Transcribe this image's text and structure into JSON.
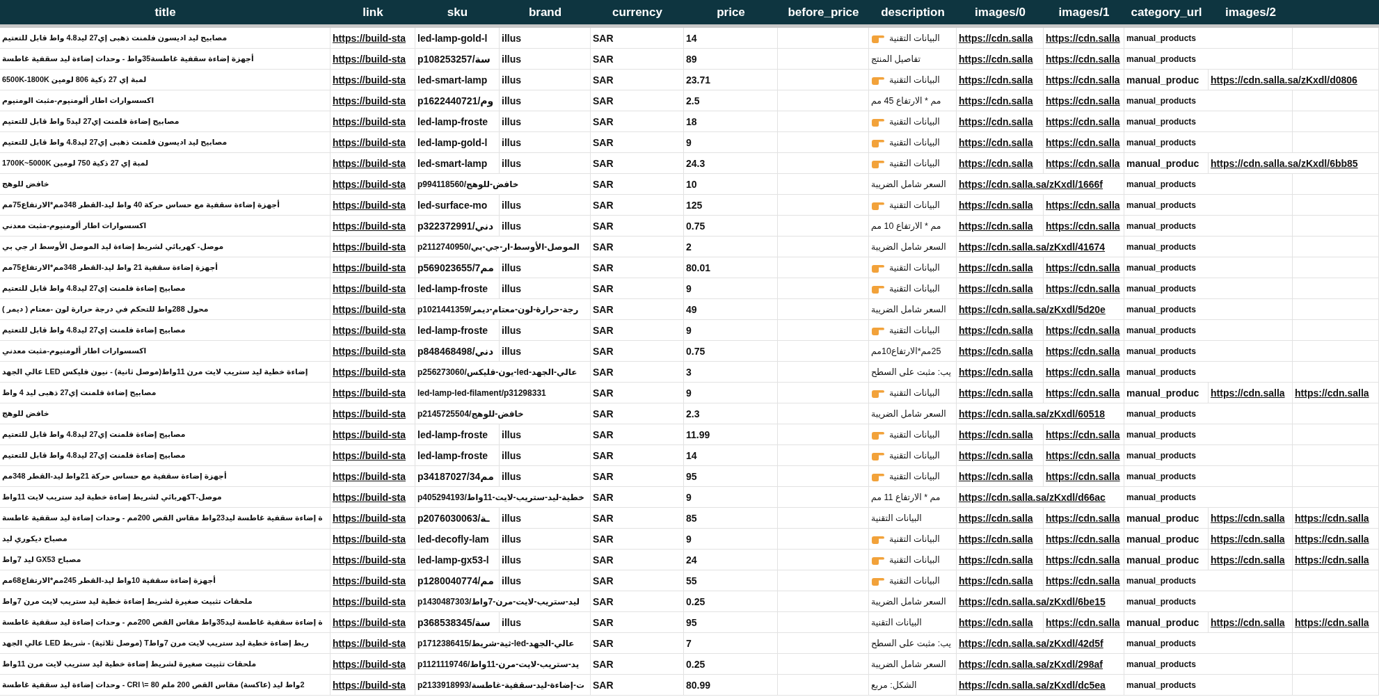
{
  "columns": [
    "title",
    "link",
    "sku",
    "brand",
    "currency",
    "price",
    "before_price",
    "description",
    "images/0",
    "images/1",
    "category_url",
    "images/2",
    ""
  ],
  "rows": [
    {
      "title": "مصابيح ليد اديسون فلمنت ذهبى إي27 ليد4.8 واط قابل للتعتيم",
      "link": "https://build-sta",
      "sku": "led-lamp-gold-l",
      "brand": "illus",
      "currency": "SAR",
      "price": "14",
      "description": {
        "text": "البيانات التقنية",
        "icon": true
      },
      "images/0": "https://cdn.salla",
      "images/1": "https://cdn.salla",
      "category_url": "manual_products"
    },
    {
      "title": "أجهزة إضاءة سقفية غاطسة35واط - وحدات إضاءة ليد سقفية غاطسة",
      "link": "https://build-sta",
      "sku": "p108253257/سة",
      "brand": "illus",
      "currency": "SAR",
      "price": "89",
      "description": {
        "text": "تفاصيل المنتج",
        "icon": false
      },
      "images/0": "https://cdn.salla",
      "images/1": "https://cdn.salla",
      "category_url": "manual_products"
    },
    {
      "title": "لمبة إي 27 ذكية 806 لومين 6500K-1800K",
      "link": "https://build-sta",
      "sku": "led-smart-lamp",
      "brand": "illus",
      "currency": "SAR",
      "price": "23.71",
      "description": {
        "text": "البيانات التقنية",
        "icon": true
      },
      "images/0": "https://cdn.salla",
      "images/1": "https://cdn.salla",
      "category_url": "manual_produc",
      "images/2": "https://cdn.salla.sa/zKxdl/d0806"
    },
    {
      "title": "اكسسوارات اطار ألومنيوم-مثبت الومنيوم",
      "link": "https://build-sta",
      "sku": "p1622440721/وم",
      "brand": "illus",
      "currency": "SAR",
      "price": "2.5",
      "description": {
        "text": "مم * الارتفاع 45 مم",
        "icon": false
      },
      "images/0": "https://cdn.salla",
      "images/1": "https://cdn.salla",
      "category_url": "manual_products"
    },
    {
      "title": "مصابيح إضاءة فلمنت إي27 ليد5 واط قابل للتعتيم",
      "link": "https://build-sta",
      "sku": "led-lamp-froste",
      "brand": "illus",
      "currency": "SAR",
      "price": "18",
      "description": {
        "text": "البيانات التقنية",
        "icon": true
      },
      "images/0": "https://cdn.salla",
      "images/1": "https://cdn.salla",
      "category_url": "manual_products"
    },
    {
      "title": "مصابيح ليد اديسون فلمنت ذهبى إي27 ليد4.8 واط قابل للتعتيم",
      "link": "https://build-sta",
      "sku": "led-lamp-gold-l",
      "brand": "illus",
      "currency": "SAR",
      "price": "9",
      "description": {
        "text": "البيانات التقنية",
        "icon": true
      },
      "images/0": "https://cdn.salla",
      "images/1": "https://cdn.salla",
      "category_url": "manual_products"
    },
    {
      "title": "لمبة إي 27 ذكية 750 لومين 1700K~5000K",
      "link": "https://build-sta",
      "sku": "led-smart-lamp",
      "brand": "illus",
      "currency": "SAR",
      "price": "24.3",
      "description": {
        "text": "البيانات التقنية",
        "icon": true
      },
      "images/0": "https://cdn.salla",
      "images/1": "https://cdn.salla",
      "category_url": "manual_produc",
      "images/2": "https://cdn.salla.sa/zKxdl/6bb85"
    },
    {
      "title": "خافض للوهج",
      "link": "https://build-sta",
      "sku": "p994118560/خافض-للوهج",
      "currency": "SAR",
      "price": "10",
      "description": {
        "text": "السعر شامل الضريبة",
        "icon": false
      },
      "images/0": "https://cdn.salla.sa/zKxdl/1666f",
      "category_url": "manual_products"
    },
    {
      "title": "أجهزة إضاءة سقفية مع حساس حركة 40 واط ليد-القطر 348مم*الارتفاع75مم",
      "link": "https://build-sta",
      "sku": "led-surface-mo",
      "brand": "illus",
      "currency": "SAR",
      "price": "125",
      "description": {
        "text": "البيانات التقنية",
        "icon": true
      },
      "images/0": "https://cdn.salla",
      "images/1": "https://cdn.salla",
      "category_url": "manual_products"
    },
    {
      "title": "اكسسوارات اطار ألومنيوم-مثبت معدني",
      "link": "https://build-sta",
      "sku": "p322372991/دني",
      "brand": "illus",
      "currency": "SAR",
      "price": "0.75",
      "description": {
        "text": "مم * الارتفاع 10 مم",
        "icon": false
      },
      "images/0": "https://cdn.salla",
      "images/1": "https://cdn.salla",
      "category_url": "manual_products"
    },
    {
      "title": "موصل- كهربائي لشريط إضاءة ليد الموصل الأوسط ار جي بي",
      "link": "https://build-sta",
      "sku": "p2112740950/الموصل-الأوسط-ار-جي-بي",
      "currency": "SAR",
      "price": "2",
      "description": {
        "text": "السعر شامل الضريبة",
        "icon": false
      },
      "images/0": "https://cdn.salla.sa/zKxdl/41674",
      "category_url": "manual_products"
    },
    {
      "title": "أجهزة إضاءة سقفية 21 واط ليد-القطر 348مم*الارتفاع75مم",
      "link": "https://build-sta",
      "sku": "p569023655/7مم",
      "brand": "illus",
      "currency": "SAR",
      "price": "80.01",
      "description": {
        "text": "البيانات التقنية",
        "icon": true
      },
      "images/0": "https://cdn.salla",
      "images/1": "https://cdn.salla",
      "category_url": "manual_products"
    },
    {
      "title": "مصابيح إضاءة فلمنت إي27 ليد4.8 واط قابل للتعتيم",
      "link": "https://build-sta",
      "sku": "led-lamp-froste",
      "brand": "illus",
      "currency": "SAR",
      "price": "9",
      "description": {
        "text": "البيانات التقنية",
        "icon": true
      },
      "images/0": "https://cdn.salla",
      "images/1": "https://cdn.salla",
      "category_url": "manual_products"
    },
    {
      "title": "محول 288واط للتحكم في درجة حرارة لون -معتام ( ديمر )",
      "link": "https://build-sta",
      "sku": "p1021441359/رجة-حرارة-لون-معتام-ديمر",
      "currency": "SAR",
      "price": "49",
      "description": {
        "text": "السعر شامل الضريبة",
        "icon": false
      },
      "images/0": "https://cdn.salla.sa/zKxdl/5d20e",
      "category_url": "manual_products"
    },
    {
      "title": "مصابيح إضاءة فلمنت إي27 ليد4.8 واط قابل للتعتيم",
      "link": "https://build-sta",
      "sku": "led-lamp-froste",
      "brand": "illus",
      "currency": "SAR",
      "price": "9",
      "description": {
        "text": "البيانات التقنية",
        "icon": true
      },
      "images/0": "https://cdn.salla",
      "images/1": "https://cdn.salla",
      "category_url": "manual_products"
    },
    {
      "title": "اكسسوارات اطار ألومنيوم-مثبت معدني",
      "link": "https://build-sta",
      "sku": "p848468498/دني",
      "brand": "illus",
      "currency": "SAR",
      "price": "0.75",
      "description": {
        "text": "25مم*الارتفاع10مم",
        "icon": false
      },
      "images/0": "https://cdn.salla",
      "images/1": "https://cdn.salla",
      "category_url": "manual_products"
    },
    {
      "title": "إضاءة خطية ليد ستريب لايت مرن 11واط(موصل ثانية) - نيون فليكس LED عالي الجهد",
      "link": "https://build-sta",
      "sku": "p256273060/يون-فليكس-led-عالي-الجهد",
      "currency": "SAR",
      "price": "3",
      "description": {
        "text": "يب: مثبت على السطح",
        "icon": false
      },
      "images/0": "https://cdn.salla",
      "images/1": "https://cdn.salla",
      "category_url": "manual_products"
    },
    {
      "title": "مصابيح إضاءة فلمنت إي27 ذهبى ليد 4 واط",
      "link": "https://build-sta",
      "sku": "led-lamp-led-filament/p31298331",
      "currency": "SAR",
      "price": "9",
      "description": {
        "text": "البيانات التقنية",
        "icon": true
      },
      "images/0": "https://cdn.salla",
      "images/1": "https://cdn.salla",
      "category_url": "manual_produc",
      "images/2": "https://cdn.salla",
      "column_13": "https://cdn.salla"
    },
    {
      "title": "خافض للوهج",
      "link": "https://build-sta",
      "sku": "p2145725504/خافض-للوهج",
      "currency": "SAR",
      "price": "2.3",
      "description": {
        "text": "السعر شامل الضريبة",
        "icon": false
      },
      "images/0": "https://cdn.salla.sa/zKxdl/60518",
      "category_url": "manual_products"
    },
    {
      "title": "مصابيح إضاءة فلمنت إي27 ليد4.8 واط قابل للتعتيم",
      "link": "https://build-sta",
      "sku": "led-lamp-froste",
      "brand": "illus",
      "currency": "SAR",
      "price": "11.99",
      "description": {
        "text": "البيانات التقنية",
        "icon": true
      },
      "images/0": "https://cdn.salla",
      "images/1": "https://cdn.salla",
      "category_url": "manual_products"
    },
    {
      "title": "مصابيح إضاءة فلمنت إي27 ليد4.8 واط قابل للتعتيم",
      "link": "https://build-sta",
      "sku": "led-lamp-froste",
      "brand": "illus",
      "currency": "SAR",
      "price": "14",
      "description": {
        "text": "البيانات التقنية",
        "icon": true
      },
      "images/0": "https://cdn.salla",
      "images/1": "https://cdn.salla",
      "category_url": "manual_products"
    },
    {
      "title": "أجهزة إضاءة سقفية مع حساس حركة 21واط ليد-القطر 348مم",
      "link": "https://build-sta",
      "sku": "p34187027/34مم",
      "brand": "illus",
      "currency": "SAR",
      "price": "95",
      "description": {
        "text": "البيانات التقنية",
        "icon": true
      },
      "images/0": "https://cdn.salla",
      "images/1": "https://cdn.salla",
      "category_url": "manual_products"
    },
    {
      "title": "موصل-Tكهربائي لشريط إضاءة خطية ليد ستريب لايت 11واط",
      "link": "https://build-sta",
      "sku": "p405294193/خطية-ليد-ستريب-لايت-11واط",
      "currency": "SAR",
      "price": "9",
      "description": {
        "text": "مم * الارتفاع 11 مم",
        "icon": false
      },
      "images/0": "https://cdn.salla.sa/zKxdl/d66ac",
      "category_url": "manual_products"
    },
    {
      "title": "ة إضاءة سقفية غاطسة ليد23واط مقاس القص 200مم - وحدات إضاءة ليد سقفية غاطسة",
      "link": "https://build-sta",
      "sku": "p2076030063/ـة",
      "brand": "illus",
      "currency": "SAR",
      "price": "85",
      "description": {
        "text": "البيانات التقنية",
        "icon": false
      },
      "images/0": "https://cdn.salla",
      "images/1": "https://cdn.salla",
      "category_url": "manual_produc",
      "images/2": "https://cdn.salla",
      "column_13": "https://cdn.salla"
    },
    {
      "title": "مصباح ديكوري ليد",
      "link": "https://build-sta",
      "sku": "led-decofly-lam",
      "brand": "illus",
      "currency": "SAR",
      "price": "9",
      "description": {
        "text": "البيانات التقنية",
        "icon": true
      },
      "images/0": "https://cdn.salla",
      "images/1": "https://cdn.salla",
      "category_url": "manual_produc",
      "images/2": "https://cdn.salla",
      "column_13": "https://cdn.salla"
    },
    {
      "title": "مصباح GX53 ليد 7واط",
      "link": "https://build-sta",
      "sku": "led-lamp-gx53-l",
      "brand": "illus",
      "currency": "SAR",
      "price": "24",
      "description": {
        "text": "البيانات التقنية",
        "icon": true
      },
      "images/0": "https://cdn.salla",
      "images/1": "https://cdn.salla",
      "category_url": "manual_produc",
      "images/2": "https://cdn.salla",
      "column_13": "https://cdn.salla"
    },
    {
      "title": "أجهزة إضاءة سقفية 10واط ليد-القطر 245مم*الارتفاع68مم",
      "link": "https://build-sta",
      "sku": "p1280040774/مم",
      "brand": "illus",
      "currency": "SAR",
      "price": "55",
      "description": {
        "text": "البيانات التقنية",
        "icon": true
      },
      "images/0": "https://cdn.salla",
      "images/1": "https://cdn.salla",
      "category_url": "manual_products"
    },
    {
      "title": "ملحقات تثبيت صغيرة لشريط إضاءة خطية ليد ستريب لايت مرن 7واط",
      "link": "https://build-sta",
      "sku": "p1430487303/ليد-ستريب-لايت-مرن-7واط",
      "currency": "SAR",
      "price": "0.25",
      "description": {
        "text": "السعر شامل الضريبة",
        "icon": false
      },
      "images/0": "https://cdn.salla.sa/zKxdl/6be15",
      "category_url": "manual_products"
    },
    {
      "title": "ة إضاءة سقفية غاطسة ليد35واط مقاس القص 200مم - وحدات إضاءة ليد سقفية غاطسة",
      "link": "https://build-sta",
      "sku": "p368538345/سة",
      "brand": "illus",
      "currency": "SAR",
      "price": "95",
      "description": {
        "text": "البيانات التقنية",
        "icon": false
      },
      "images/0": "https://cdn.salla",
      "images/1": "https://cdn.salla",
      "category_url": "manual_produc",
      "images/2": "https://cdn.salla",
      "column_13": "https://cdn.salla"
    },
    {
      "title": "ريط إضاءة خطية ليد ستريب لايت مرن 7واطT (موصل ثلاثية) - شريط LED عالي الجهد",
      "link": "https://build-sta",
      "sku": "p1712386415/ثية-شريط-led-عالي-الجهد",
      "currency": "SAR",
      "price": "7",
      "description": {
        "text": "يب: مثبت على السطح",
        "icon": false
      },
      "images/0": "https://cdn.salla.sa/zKxdl/42d5f",
      "category_url": "manual_products"
    },
    {
      "title": "ملحقات تثبيت صغيرة لشريط إضاءة خطية ليد ستريب لايت مرن 11واط",
      "link": "https://build-sta",
      "sku": "p1121119746/يد-ستريب-لايت-مرن-11واط",
      "currency": "SAR",
      "price": "0.25",
      "description": {
        "text": "السعر شامل الضريبة",
        "icon": false
      },
      "images/0": "https://cdn.salla.sa/zKxdl/298af",
      "category_url": "manual_products"
    },
    {
      "title": "2واط ليد (عاكسة) مقاس القص 200 ملم CRI \\= 80 - وحدات إضاءة ليد سقفية غاطسة",
      "link": "https://build-sta",
      "sku": "p2133918993/ت-إضاءة-ليد-سقفية-غاطسة",
      "currency": "SAR",
      "price": "80.99",
      "description": {
        "text": "الشكل: مربع",
        "icon": false
      },
      "images/0": "https://cdn.salla.sa/zKxdl/dc5ea",
      "category_url": "manual_products"
    }
  ]
}
